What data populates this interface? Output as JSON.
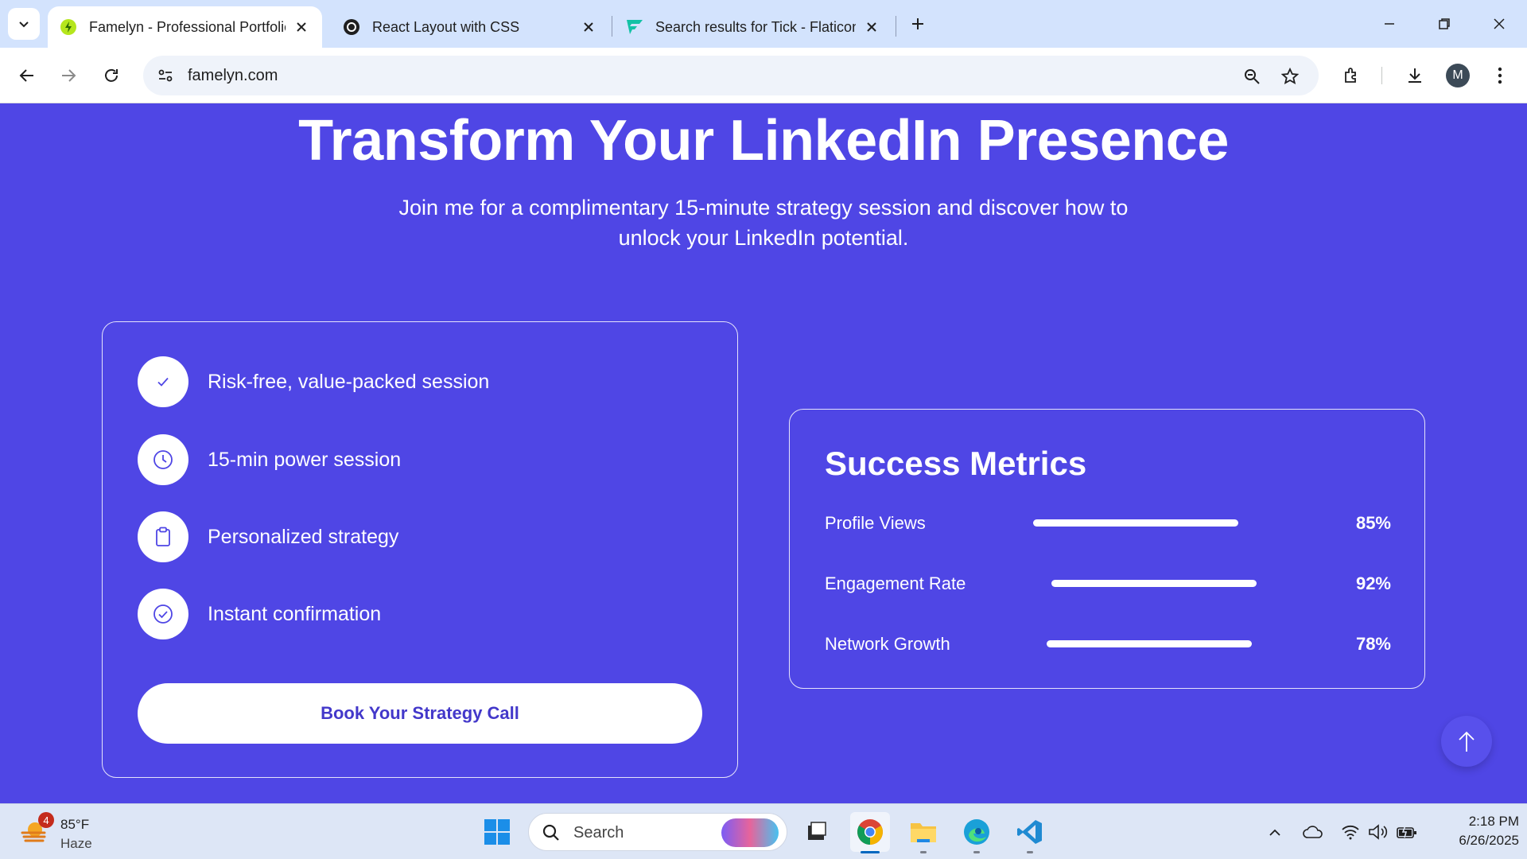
{
  "browser": {
    "tabs": [
      {
        "title": "Famelyn - Professional Portfolio",
        "icon": "famelyn-logo-icon",
        "active": true
      },
      {
        "title": "React Layout with CSS",
        "icon": "chatgpt-icon",
        "active": false
      },
      {
        "title": "Search results for Tick - Flaticon",
        "icon": "flaticon-icon",
        "active": false
      }
    ],
    "url": "famelyn.com",
    "profile_initial": "M"
  },
  "hero": {
    "title": "Transform Your LinkedIn Presence",
    "subtitle": "Join me for a complimentary 15-minute strategy session and discover how to unlock your LinkedIn potential."
  },
  "benefits": {
    "items": [
      {
        "label": "Risk-free, value-packed session",
        "icon": "check-icon"
      },
      {
        "label": "15-min power session",
        "icon": "clock-icon"
      },
      {
        "label": "Personalized strategy",
        "icon": "clipboard-icon"
      },
      {
        "label": "Instant confirmation",
        "icon": "check-circle-icon"
      }
    ],
    "cta_label": "Book Your Strategy Call"
  },
  "metrics": {
    "title": "Success Metrics",
    "items": [
      {
        "label": "Profile Views",
        "value": "85%"
      },
      {
        "label": "Engagement Rate",
        "value": "92%"
      },
      {
        "label": "Network Growth",
        "value": "78%"
      }
    ]
  },
  "taskbar": {
    "weather": {
      "temp": "85°F",
      "condition": "Haze",
      "badge": "4"
    },
    "search_placeholder": "Search",
    "clock": {
      "time": "2:18 PM",
      "date": "6/26/2025"
    }
  },
  "colors": {
    "page_background": "#4f46e5",
    "cta_text": "#4338ca",
    "tabstrip": "#d3e3fd"
  }
}
